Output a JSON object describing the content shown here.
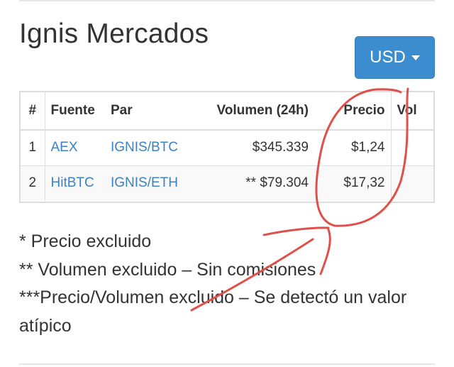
{
  "page": {
    "title": "Ignis Mercados",
    "currency_button": "USD"
  },
  "table": {
    "headers": [
      "#",
      "Fuente",
      "Par",
      "Volumen (24h)",
      "Precio",
      "Vol"
    ],
    "rows": [
      [
        "1",
        "AEX",
        "IGNIS/BTC",
        "$345.339",
        "$1,24",
        ""
      ],
      [
        "2",
        "HitBTC",
        "IGNIS/ETH",
        "** $79.304",
        "$17,32",
        ""
      ]
    ]
  },
  "footnotes": [
    "* Precio excluido",
    "** Volumen excluido – Sin comisiones",
    "***Precio/Volumen excluido – Se detectó un valor atípico"
  ],
  "colors": {
    "link": "#3a82c4",
    "button": "#3c8dcf",
    "annotation": "#e0504a"
  }
}
